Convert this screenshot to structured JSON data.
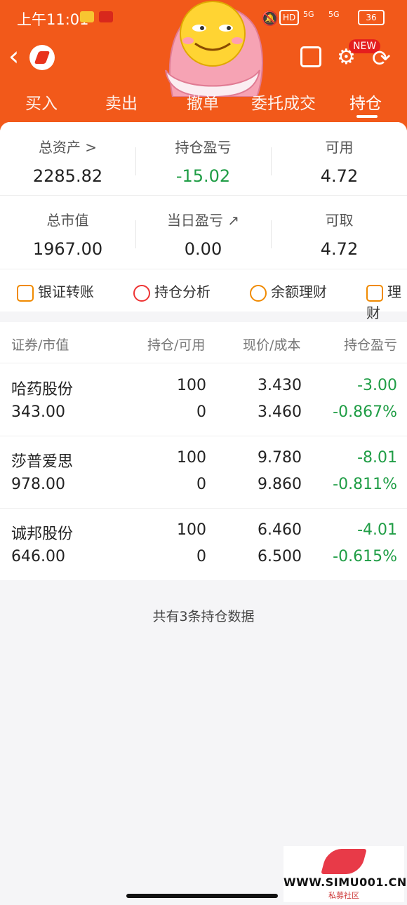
{
  "status_bar": {
    "time": "上午11:01",
    "network": "5G",
    "hd": "HD",
    "battery": "36"
  },
  "header": {
    "new_badge": "NEW",
    "tabs": [
      {
        "label": "买入",
        "active": false
      },
      {
        "label": "卖出",
        "active": false
      },
      {
        "label": "撤单",
        "active": false
      },
      {
        "label": "委托成交",
        "active": false
      },
      {
        "label": "持仓",
        "active": true
      }
    ]
  },
  "summary": {
    "row1": [
      {
        "label": "总资产 >",
        "value": "2285.82"
      },
      {
        "label": "持仓盈亏",
        "value": "-15.02",
        "color": "#1f9d45"
      },
      {
        "label": "可用",
        "value": "4.72"
      }
    ],
    "row2": [
      {
        "label": "总市值",
        "value": "1967.00"
      },
      {
        "label": "当日盈亏 ↗",
        "value": "0.00"
      },
      {
        "label": "可取",
        "value": "4.72"
      }
    ]
  },
  "quick_actions": [
    {
      "label": "银证转账",
      "icon": "transfer-icon"
    },
    {
      "label": "持仓分析",
      "icon": "pie-icon"
    },
    {
      "label": "余额理财",
      "icon": "piggy-icon"
    },
    {
      "label": "理财",
      "icon": "moneybag-icon"
    }
  ],
  "table": {
    "headers": [
      "证券/市值",
      "持仓/可用",
      "现价/成本",
      "持仓盈亏"
    ],
    "rows": [
      {
        "name": "哈药股份",
        "market_value": "343.00",
        "position": "100",
        "available": "0",
        "price": "3.430",
        "cost": "3.460",
        "pnl": "-3.00",
        "pnl_pct": "-0.867%"
      },
      {
        "name": "莎普爱思",
        "market_value": "978.00",
        "position": "100",
        "available": "0",
        "price": "9.780",
        "cost": "9.860",
        "pnl": "-8.01",
        "pnl_pct": "-0.811%"
      },
      {
        "name": "诚邦股份",
        "market_value": "646.00",
        "position": "100",
        "available": "0",
        "price": "6.460",
        "cost": "6.500",
        "pnl": "-4.01",
        "pnl_pct": "-0.615%"
      }
    ]
  },
  "footer_note": "共有3条持仓数据",
  "watermark": {
    "text": "WWW.SIMU001.CN",
    "sub": "私募社区"
  },
  "colors": {
    "brand": "#f2591a",
    "loss": "#1f9d45"
  }
}
